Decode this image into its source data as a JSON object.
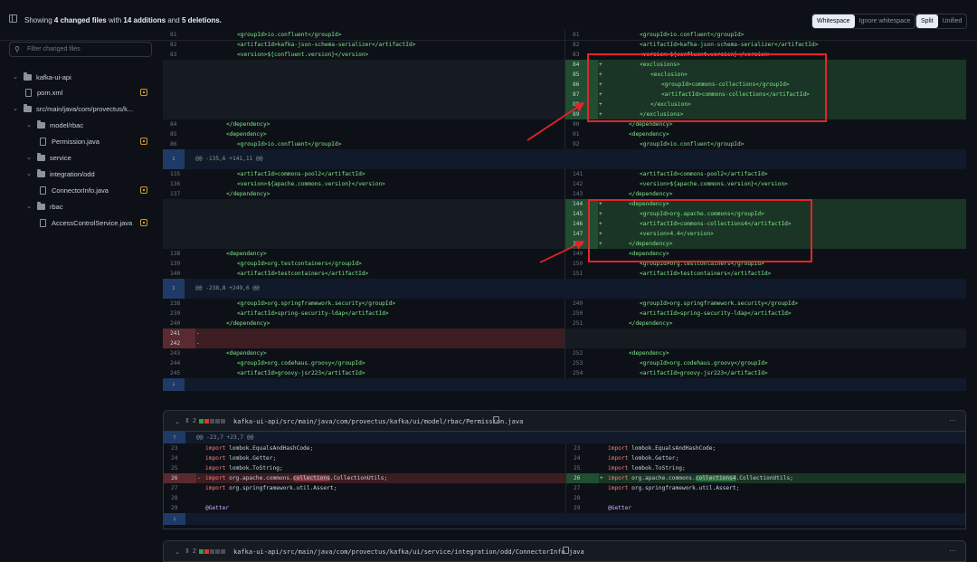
{
  "header": {
    "summary_prefix": "Showing",
    "summary_files": "4 changed files",
    "summary_mid": "with",
    "summary_add": "14 additions",
    "summary_and": "and",
    "summary_del": "5 deletions.",
    "whitespace": [
      "Whitespace",
      "Ignore whitespace"
    ],
    "view": [
      "Split",
      "Unified"
    ],
    "whitespace_selected": "Whitespace",
    "view_selected": "Split"
  },
  "sidebar": {
    "filter_placeholder": "Filter changed files",
    "items": [
      {
        "label": "kafka-ui-api",
        "type": "folder"
      },
      {
        "label": "pom.xml",
        "type": "file",
        "modified": true
      },
      {
        "label": "src/main/java/com/provectus/k...",
        "type": "folder"
      },
      {
        "label": "model/rbac",
        "type": "folder"
      },
      {
        "label": "Permission.java",
        "type": "file",
        "modified": true
      },
      {
        "label": "service",
        "type": "folder"
      },
      {
        "label": "integration/odd",
        "type": "folder"
      },
      {
        "label": "ConnectorInfo.java",
        "type": "file",
        "modified": true
      },
      {
        "label": "rbac",
        "type": "folder"
      },
      {
        "label": "AccessControlService.java",
        "type": "file",
        "modified": true
      }
    ]
  },
  "pom_diff": {
    "rows": [
      {
        "t": "ctx",
        "l": "81",
        "lc": "<groupId>io.confluent</groupId>",
        "r": "81",
        "rc": "<groupId>io.confluent</groupId>",
        "li": 3
      },
      {
        "t": "ctx",
        "l": "82",
        "lc": "<artifactId>kafka-json-schema-serializer</artifactId>",
        "r": "82",
        "rc": "<artifactId>kafka-json-schema-serializer</artifactId>",
        "li": 3
      },
      {
        "t": "ctx",
        "l": "83",
        "lc": "<version>${confluent.version}</version>",
        "r": "83",
        "rc": "<version>${confluent.version}</version>",
        "li": 3
      },
      {
        "t": "add",
        "r": "84",
        "rc": "<exclusions>",
        "li": 3
      },
      {
        "t": "add",
        "r": "85",
        "rc": "<exclusion>",
        "li": 4
      },
      {
        "t": "add",
        "r": "86",
        "rc": "<groupId>commons-collections</groupId>",
        "li": 5
      },
      {
        "t": "add",
        "r": "87",
        "rc": "<artifactId>commons-collections</artifactId>",
        "li": 5
      },
      {
        "t": "add",
        "r": "88",
        "rc": "</exclusion>",
        "li": 4
      },
      {
        "t": "add",
        "r": "89",
        "rc": "</exclusions>",
        "li": 3
      },
      {
        "t": "ctx",
        "l": "84",
        "lc": "</dependency>",
        "r": "90",
        "rc": "</dependency>",
        "li": 2
      },
      {
        "t": "ctx",
        "l": "85",
        "lc": "<dependency>",
        "r": "91",
        "rc": "<dependency>",
        "li": 2
      },
      {
        "t": "ctx",
        "l": "86",
        "lc": "<groupId>io.confluent</groupId>",
        "r": "92",
        "rc": "<groupId>io.confluent</groupId>",
        "li": 3
      },
      {
        "t": "hunk",
        "text": "@@ -135,6 +141,11 @@"
      },
      {
        "t": "ctx",
        "l": "135",
        "lc": "<artifactId>commons-pool2</artifactId>",
        "r": "141",
        "rc": "<artifactId>commons-pool2</artifactId>",
        "li": 3
      },
      {
        "t": "ctx",
        "l": "136",
        "lc": "<version>${apache.commons.version}</version>",
        "r": "142",
        "rc": "<version>${apache.commons.version}</version>",
        "li": 3
      },
      {
        "t": "ctx",
        "l": "137",
        "lc": "</dependency>",
        "r": "143",
        "rc": "</dependency>",
        "li": 2
      },
      {
        "t": "add",
        "r": "144",
        "rc": "<dependency>",
        "li": 2
      },
      {
        "t": "add",
        "r": "145",
        "rc": "<groupId>org.apache.commons</groupId>",
        "li": 3
      },
      {
        "t": "add",
        "r": "146",
        "rc": "<artifactId>commons-collections4</artifactId>",
        "li": 3
      },
      {
        "t": "add",
        "r": "147",
        "rc": "<version>4.4</version>",
        "li": 3
      },
      {
        "t": "add",
        "r": "148",
        "rc": "</dependency>",
        "li": 2
      },
      {
        "t": "ctx",
        "l": "138",
        "lc": "<dependency>",
        "r": "149",
        "rc": "<dependency>",
        "li": 2
      },
      {
        "t": "ctx",
        "l": "139",
        "lc": "<groupId>org.testcontainers</groupId>",
        "r": "150",
        "rc": "<groupId>org.testcontainers</groupId>",
        "li": 3
      },
      {
        "t": "ctx",
        "l": "140",
        "lc": "<artifactId>testcontainers</artifactId>",
        "r": "151",
        "rc": "<artifactId>testcontainers</artifactId>",
        "li": 3
      },
      {
        "t": "hunk",
        "text": "@@ -238,8 +249,6 @@"
      },
      {
        "t": "ctx",
        "l": "238",
        "lc": "<groupId>org.springframework.security</groupId>",
        "r": "249",
        "rc": "<groupId>org.springframework.security</groupId>",
        "li": 3
      },
      {
        "t": "ctx",
        "l": "239",
        "lc": "<artifactId>spring-security-ldap</artifactId>",
        "r": "250",
        "rc": "<artifactId>spring-security-ldap</artifactId>",
        "li": 3
      },
      {
        "t": "ctx",
        "l": "240",
        "lc": "</dependency>",
        "r": "251",
        "rc": "</dependency>",
        "li": 2
      },
      {
        "t": "del",
        "l": "241",
        "lc": ""
      },
      {
        "t": "del",
        "l": "242",
        "lc": ""
      },
      {
        "t": "ctx",
        "l": "243",
        "lc": "<dependency>",
        "r": "252",
        "rc": "<dependency>",
        "li": 2
      },
      {
        "t": "ctx",
        "l": "244",
        "lc": "<groupId>org.codehaus.groovy</groupId>",
        "r": "253",
        "rc": "<groupId>org.codehaus.groovy</groupId>",
        "li": 3
      },
      {
        "t": "ctx",
        "l": "245",
        "lc": "<artifactId>groovy-jsr223</artifactId>",
        "r": "254",
        "rc": "<artifactId>groovy-jsr223</artifactId>",
        "li": 3
      }
    ]
  },
  "permission_file": {
    "count": "2",
    "path": "kafka-ui-api/src/main/java/com/provectus/kafka/ui/model/rbac/Permission.java",
    "blocks": [
      "#2ea043",
      "#da3633",
      "#484f58",
      "#484f58",
      "#484f58"
    ],
    "more": "···",
    "hunk": "@@ -23,7 +23,7 @@",
    "rows": [
      {
        "t": "ctx",
        "l": "23",
        "r": "23",
        "k": "import",
        "c": " lombok.EqualsAndHashCode;"
      },
      {
        "t": "ctx",
        "l": "24",
        "r": "24",
        "k": "import",
        "c": " lombok.Getter;"
      },
      {
        "t": "ctx",
        "l": "25",
        "r": "25",
        "k": "import",
        "c": " lombok.ToString;"
      },
      {
        "t": "chg",
        "l": "26",
        "r": "26",
        "k": "import",
        "pre": " org.apache.commons.",
        "lhl": "collections",
        "rhl": "collections4",
        "post": ".CollectionUtils;"
      },
      {
        "t": "ctx",
        "l": "27",
        "r": "27",
        "k": "import",
        "c": " org.springframework.util.Assert;"
      },
      {
        "t": "ctx",
        "l": "28",
        "r": "28",
        "k": "",
        "c": ""
      },
      {
        "t": "ctx",
        "l": "29",
        "r": "29",
        "a": "@Getter",
        "c": ""
      }
    ]
  },
  "connector_file": {
    "count": "2",
    "path": "kafka-ui-api/src/main/java/com/provectus/kafka/ui/service/integration/odd/ConnectorInfo.java",
    "blocks": [
      "#2ea043",
      "#da3633",
      "#484f58",
      "#484f58",
      "#484f58"
    ],
    "more": "···"
  },
  "colors": {
    "addition": "#2ea043",
    "deletion": "#da3633",
    "annotation_box": "#e5242a",
    "modified": "#d29922"
  },
  "icons": [
    "sidebar-toggle-icon",
    "search-icon",
    "chevron-down-icon",
    "folder-icon",
    "file-icon",
    "modified-file-icon",
    "expand-up-icon",
    "expand-down-icon",
    "copy-icon",
    "kebab-icon"
  ]
}
